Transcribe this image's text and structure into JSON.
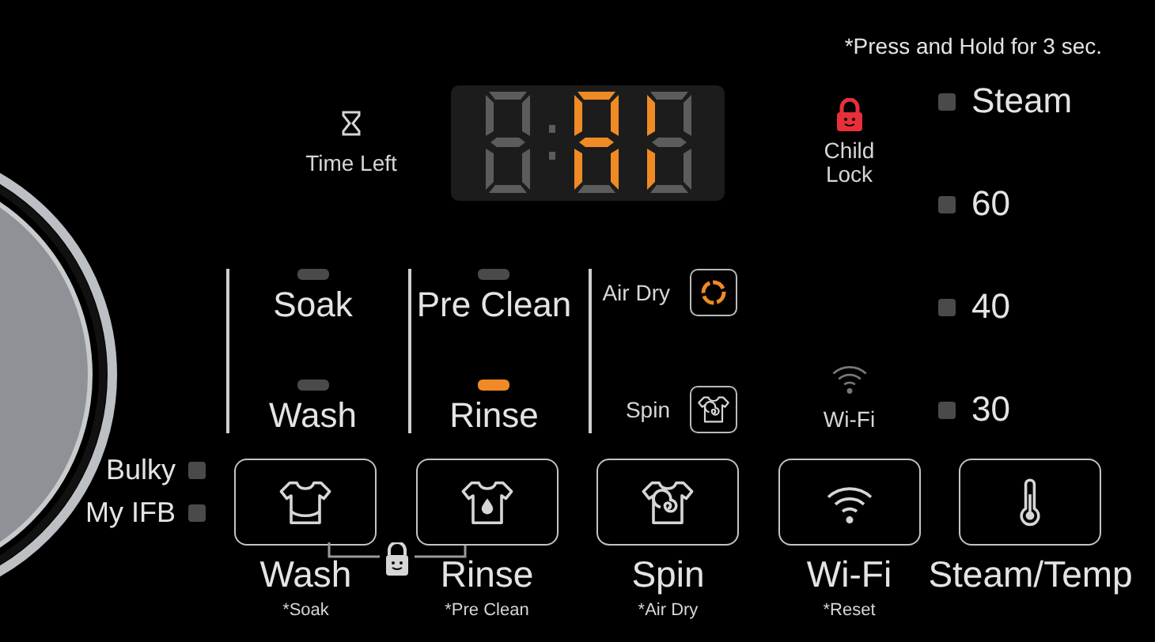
{
  "note": "*Press and Hold for 3 sec.",
  "time_left": {
    "label": "Time Left"
  },
  "display": {
    "digits": [
      {
        "segments": {
          "a": false,
          "b": false,
          "c": false,
          "d": false,
          "e": false,
          "f": false,
          "g": false
        }
      },
      {
        "segments": {
          "a": true,
          "b": true,
          "c": true,
          "d": false,
          "e": true,
          "f": true,
          "g": true
        }
      },
      {
        "segments": {
          "a": false,
          "b": false,
          "c": false,
          "d": false,
          "e": true,
          "f": true,
          "g": false
        }
      }
    ]
  },
  "child_lock": {
    "label_lines": [
      "Child",
      "Lock"
    ],
    "active": true
  },
  "temperatures": [
    {
      "label": "Steam",
      "selected": false
    },
    {
      "label": "60",
      "selected": false
    },
    {
      "label": "40",
      "selected": false
    },
    {
      "label": "30",
      "selected": false
    }
  ],
  "stages": [
    {
      "kind": "led",
      "items": [
        {
          "label": "Soak",
          "lit": false
        },
        {
          "label": "Wash",
          "lit": false
        }
      ]
    },
    {
      "kind": "led",
      "items": [
        {
          "label": "Pre Clean",
          "lit": false
        },
        {
          "label": "Rinse",
          "lit": true
        }
      ]
    },
    {
      "kind": "icon",
      "items": [
        {
          "label": "Air Dry"
        },
        {
          "label": "Spin"
        }
      ]
    }
  ],
  "wifi_indicator": {
    "label": "Wi-Fi"
  },
  "options": [
    {
      "label": "Bulky",
      "on": false
    },
    {
      "label": "My IFB",
      "on": false
    }
  ],
  "buttons": [
    {
      "label": "Wash",
      "sub": "*Soak"
    },
    {
      "label": "Rinse",
      "sub": "*Pre Clean"
    },
    {
      "label": "Spin",
      "sub": "*Air Dry"
    },
    {
      "label": "Wi-Fi",
      "sub": "*Reset"
    },
    {
      "label": "Steam/Temp"
    }
  ]
}
